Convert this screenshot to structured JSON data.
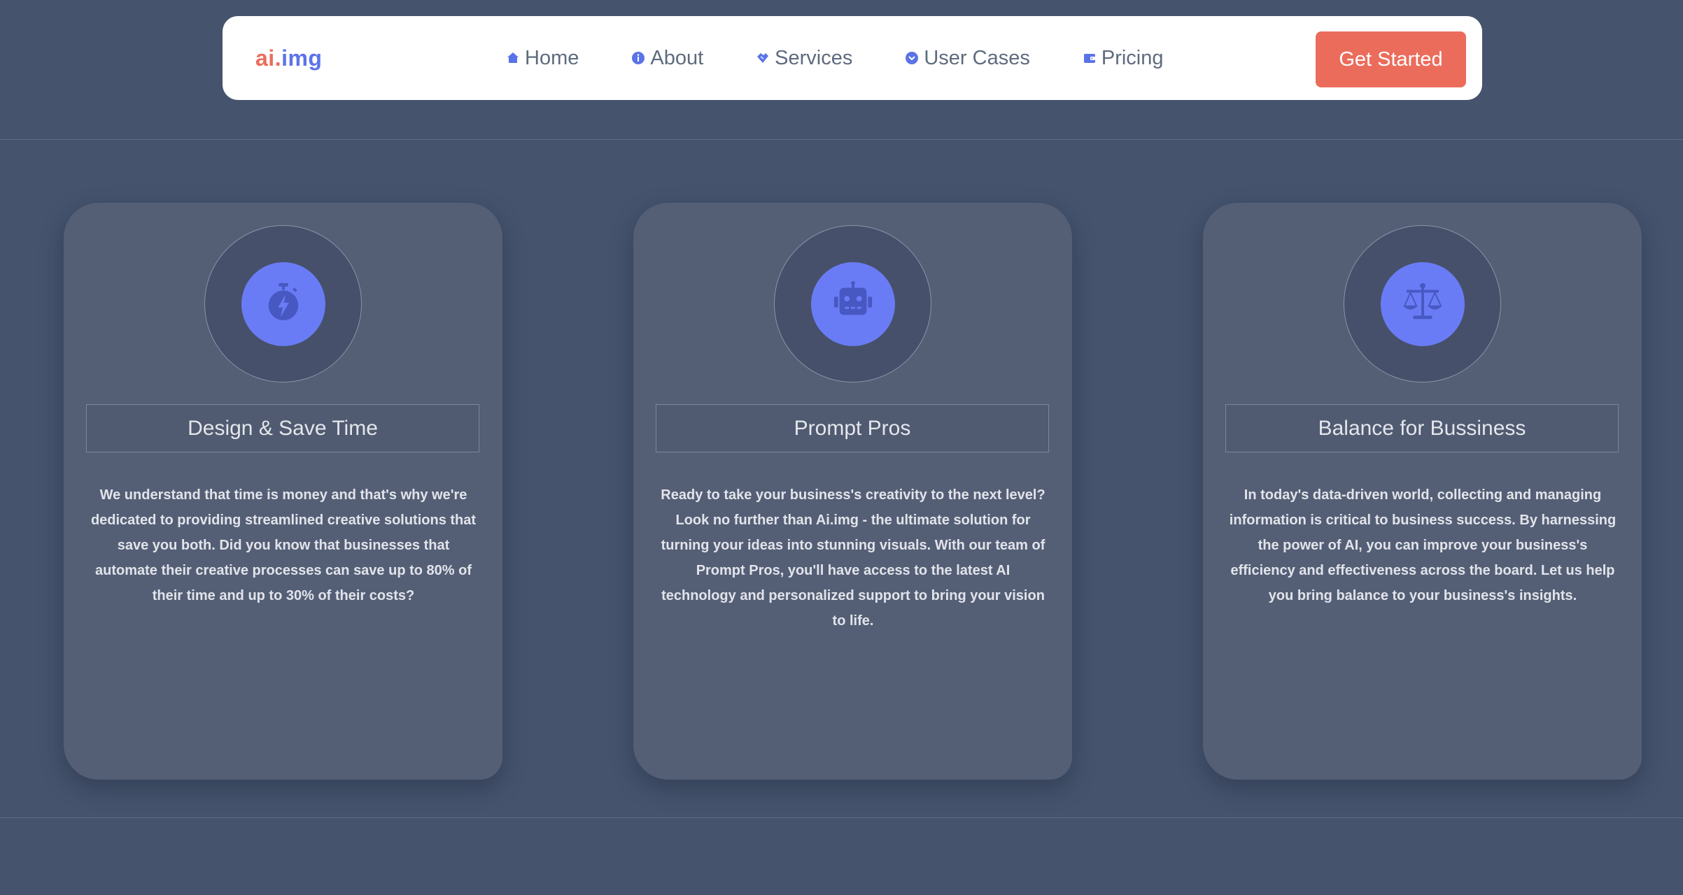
{
  "header": {
    "logo": {
      "part1": "ai",
      "part2": ".",
      "part3": "img"
    },
    "nav": [
      {
        "label": "Home",
        "icon": "home-icon"
      },
      {
        "label": "About",
        "icon": "info-icon"
      },
      {
        "label": "Services",
        "icon": "handshake-icon"
      },
      {
        "label": "User Cases",
        "icon": "chevron-circle-icon"
      },
      {
        "label": "Pricing",
        "icon": "wallet-icon"
      }
    ],
    "cta_label": "Get Started"
  },
  "cards": [
    {
      "icon": "stopwatch-bolt-icon",
      "title": "Design & Save Time",
      "text": "We understand that time is money and that's why we're dedicated to providing streamlined creative solutions that save you both. Did you know that businesses that automate their creative processes can save up to 80% of their time and up to 30% of their costs?"
    },
    {
      "icon": "robot-icon",
      "title": "Prompt Pros",
      "text": "Ready to take your business's creativity to the next level? Look no further than Ai.img - the ultimate solution for turning your ideas into stunning visuals. With our team of Prompt Pros, you'll have access to the latest AI technology and personalized support to bring your vision to life."
    },
    {
      "icon": "balance-scale-icon",
      "title": "Balance for Bussiness",
      "text": "In today's data-driven world, collecting and managing information is critical to business success. By harnessing the power of AI, you can improve your business's efficiency and effectiveness across the board. Let us help you bring balance to your business's insights."
    }
  ],
  "colors": {
    "background": "#45536d",
    "accent": "#ec6c5c",
    "brand": "#5b73e8",
    "card": "#545f76",
    "icon_disc": "#6a7cf5"
  }
}
